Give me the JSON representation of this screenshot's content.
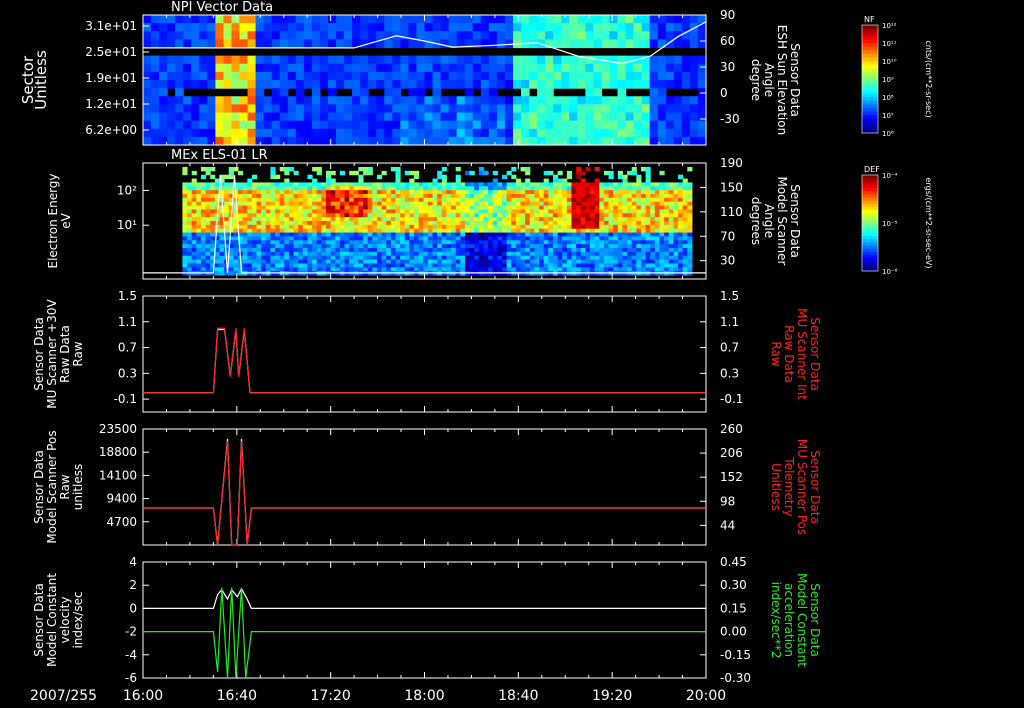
{
  "colors": {
    "background": "#000000",
    "axis": "#ffffff",
    "text": "#ffffff",
    "red_series": "#ff2020",
    "green_series": "#22ee22",
    "white_series": "#ffffff"
  },
  "chart_data": [
    {
      "type": "heatmap",
      "title": "NPI Vector Data",
      "ylabel": [
        "Sector",
        "Unitless"
      ],
      "yticks": [
        "3.1e+01",
        "2.5e+01",
        "1.9e+01",
        "1.2e+01",
        "6.2e+00"
      ],
      "right_label": [
        "Sensor Data",
        "ESH Sun Elevation",
        "Angle",
        "degree"
      ],
      "right_ticks": [
        "90",
        "60",
        "30",
        "0",
        "-30"
      ],
      "right_range": [
        -60,
        90
      ],
      "overlay_series": {
        "name": "ESH Sun Elevation Angle",
        "x_hours": [
          16.0,
          16.3,
          16.6,
          17.0,
          17.5,
          17.8,
          18.0,
          18.2,
          18.5,
          18.8,
          19.1,
          19.4,
          19.6,
          19.8,
          20.0
        ],
        "values": [
          52,
          52,
          52,
          52,
          52,
          66,
          60,
          53,
          55,
          58,
          42,
          34,
          42,
          65,
          82
        ]
      },
      "colorbar": {
        "label": "NF",
        "unit": "cnts/(cm**2-sr-sec)",
        "ticks": [
          "10¹²",
          "10¹¹",
          "10¹⁰",
          "10⁹",
          "10⁸",
          "10⁷",
          "10⁶"
        ]
      }
    },
    {
      "type": "heatmap",
      "title": "MEx ELS-01 LR",
      "ylabel": [
        "Electron Energy",
        "eV"
      ],
      "yticks": [
        "10²",
        "10¹"
      ],
      "right_label": [
        "Sensor Data",
        "Model Scanner",
        "Angle",
        "degrees"
      ],
      "right_ticks": [
        "190",
        "150",
        "110",
        "70",
        "30"
      ],
      "right_range": [
        0,
        190
      ],
      "overlay_series": {
        "name": "Model Scanner Angle",
        "x_hours": [
          16.0,
          16.4,
          16.5,
          16.55,
          16.6,
          16.65,
          16.7,
          16.75,
          20.0
        ],
        "values": [
          10,
          10,
          10,
          170,
          10,
          170,
          10,
          10,
          10
        ]
      },
      "colorbar": {
        "label": "DEF",
        "unit": "ergs/(cm**2-sr-sec-eV)",
        "ticks": [
          "10⁻⁴",
          "10⁻⁵",
          "10⁻⁶"
        ]
      }
    },
    {
      "type": "line",
      "yticks": [
        "1.5",
        "1.1",
        "0.7",
        "0.3",
        "-0.1"
      ],
      "ylim": [
        -0.3,
        1.5
      ],
      "ylabel": [
        "Sensor Data",
        "MU Scanner +30V",
        "Raw Data",
        "Raw"
      ],
      "right_ticks": [
        "1.5",
        "1.1",
        "0.7",
        "0.3",
        "-0.1"
      ],
      "right_label": [
        "Sensor Data",
        "MU Scanner Int",
        "Raw Data",
        "Raw"
      ],
      "series": [
        {
          "color": "#ffffff",
          "x": [
            16.0,
            16.5,
            16.53,
            16.58,
            16.62,
            16.66,
            16.68,
            16.72,
            16.76,
            20.0
          ],
          "y": [
            0.0,
            0.0,
            0.98,
            0.98,
            0.25,
            0.98,
            0.25,
            0.98,
            0.0,
            0.0
          ]
        },
        {
          "color": "#ff2020",
          "x": [
            16.0,
            16.5,
            16.53,
            16.58,
            16.62,
            16.66,
            16.68,
            16.72,
            16.76,
            20.0
          ],
          "y": [
            0.0,
            0.0,
            1.0,
            1.0,
            0.25,
            1.0,
            0.25,
            1.0,
            0.0,
            0.0
          ]
        }
      ]
    },
    {
      "type": "line",
      "yticks": [
        "23500",
        "18800",
        "14100",
        "9400",
        "4700"
      ],
      "ylim": [
        0,
        23500
      ],
      "ylabel": [
        "Sensor Data",
        "Model Scanner Pos",
        "Raw",
        "unitless"
      ],
      "right_ticks": [
        "260",
        "206",
        "152",
        "98",
        "44"
      ],
      "right_range": [
        0,
        260
      ],
      "right_label": [
        "Sensor Data",
        "MU Scanner Pos",
        "Telemetry",
        "Unitless"
      ],
      "series": [
        {
          "color": "#ffffff",
          "x": [
            16.0,
            16.5,
            16.53,
            16.6,
            16.63,
            16.67,
            16.7,
            16.74,
            16.77,
            20.0
          ],
          "y": [
            7500,
            7500,
            0,
            21500,
            0,
            0,
            21500,
            0,
            7500,
            7500
          ]
        },
        {
          "color": "#ff2020",
          "x": [
            16.0,
            16.5,
            16.53,
            16.6,
            16.63,
            16.67,
            16.7,
            16.74,
            16.77,
            20.0
          ],
          "y": [
            7500,
            7500,
            0,
            21000,
            0,
            0,
            21000,
            0,
            7500,
            7500
          ]
        }
      ]
    },
    {
      "type": "line",
      "yticks": [
        "4",
        "2",
        "0",
        "-2",
        "-4",
        "-6"
      ],
      "ylim": [
        -6,
        4
      ],
      "ylabel": [
        "Sensor Data",
        "Model Constant",
        "velocity",
        "index/sec"
      ],
      "right_ticks": [
        "0.45",
        "0.30",
        "0.15",
        "0.00",
        "-0.15",
        "-0.30"
      ],
      "right_range": [
        -0.3,
        0.45
      ],
      "right_label": [
        "Sensor Data",
        "Model Constant",
        "acceleration",
        "index/sec**2"
      ],
      "series": [
        {
          "color": "#ffffff",
          "x": [
            16.0,
            16.5,
            16.53,
            16.56,
            16.6,
            16.63,
            16.67,
            16.7,
            16.74,
            16.77,
            20.0
          ],
          "y": [
            0,
            0,
            1.2,
            1.6,
            0.8,
            1.6,
            1.0,
            1.7,
            0.8,
            0,
            0
          ]
        },
        {
          "color": "#22ee22",
          "x": [
            16.0,
            16.5,
            16.53,
            16.56,
            16.6,
            16.63,
            16.66,
            16.7,
            16.73,
            16.77,
            20.0
          ],
          "y": [
            -2,
            -2,
            -5.5,
            1.8,
            -6,
            1.8,
            -6,
            1.8,
            -6,
            -2,
            -2
          ]
        }
      ]
    }
  ],
  "x_axis": {
    "date": "2007/255",
    "ticks": [
      "16:00",
      "16:40",
      "17:20",
      "18:00",
      "18:40",
      "19:20",
      "20:00"
    ],
    "range_hours": [
      16.0,
      20.0
    ]
  }
}
